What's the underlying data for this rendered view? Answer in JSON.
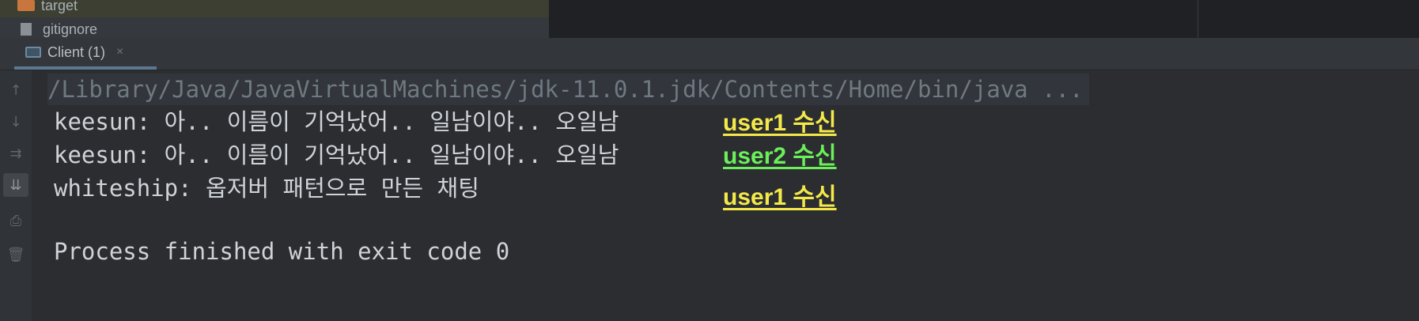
{
  "project_tree": {
    "items": [
      {
        "label": "target",
        "icon": "folder-icon"
      },
      {
        "label": "gitignore",
        "icon": "file-icon"
      }
    ]
  },
  "run_window": {
    "tab_label": "Client (1)",
    "tab_close": "×"
  },
  "gutter": {
    "buttons": [
      {
        "name": "scroll-up-icon",
        "glyph": "↑"
      },
      {
        "name": "scroll-down-icon",
        "glyph": "↓"
      },
      {
        "name": "soft-wrap-icon",
        "glyph": "⇉"
      },
      {
        "name": "scroll-to-end-icon",
        "glyph": "⇊"
      },
      {
        "name": "print-icon",
        "glyph": "⎙"
      },
      {
        "name": "trash-icon",
        "glyph": "🗑"
      }
    ]
  },
  "console": {
    "command": "/Library/Java/JavaVirtualMachines/jdk-11.0.1.jdk/Contents/Home/bin/java ...",
    "lines": [
      "keesun: 아.. 이름이 기억났어.. 일남이야.. 오일남",
      "keesun: 아.. 이름이 기억났어.. 일남이야.. 오일남",
      "whiteship: 옵저버 패턴으로 만든 채팅",
      "Process finished with exit code 0"
    ]
  },
  "annotations": [
    {
      "text": "user1 수신",
      "color": "#f4e94a"
    },
    {
      "text": "user2 수신",
      "color": "#6bef5a"
    },
    {
      "text": "user1 수신",
      "color": "#f4e94a"
    }
  ]
}
